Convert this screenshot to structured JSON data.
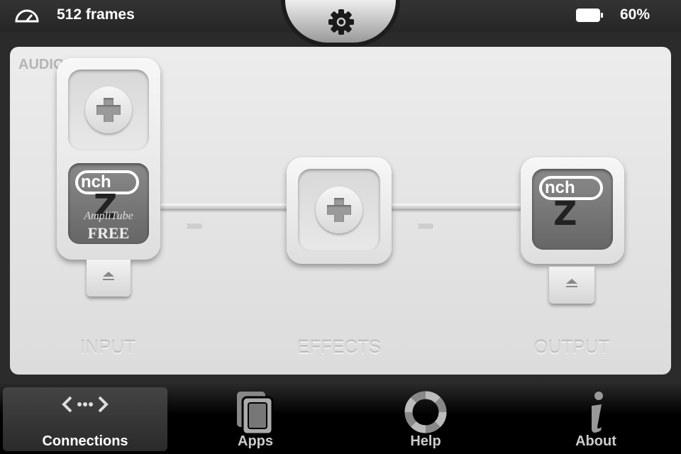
{
  "status_bar": {
    "frames": "512 frames",
    "battery": "60%",
    "gauge_icon": "gauge-icon",
    "battery_icon": "battery-icon",
    "settings_icon": "gear-icon"
  },
  "panel": {
    "title": "AUDIO",
    "input": {
      "label": "INPUT",
      "app": {
        "badge": "nch",
        "letter": "Z",
        "name": "AmpliTube",
        "tag": "FREE"
      }
    },
    "effects": {
      "label": "EFFECTS"
    },
    "output": {
      "label": "OUTPUT",
      "app": {
        "badge": "nch",
        "letter": "Z"
      }
    },
    "chevrons": "›››››››"
  },
  "tabs": [
    {
      "label": "Connections",
      "icon": "connections-icon",
      "active": true
    },
    {
      "label": "Apps",
      "icon": "apps-icon"
    },
    {
      "label": "Help",
      "icon": "lifebuoy-icon"
    },
    {
      "label": "About",
      "icon": "info-icon"
    }
  ]
}
